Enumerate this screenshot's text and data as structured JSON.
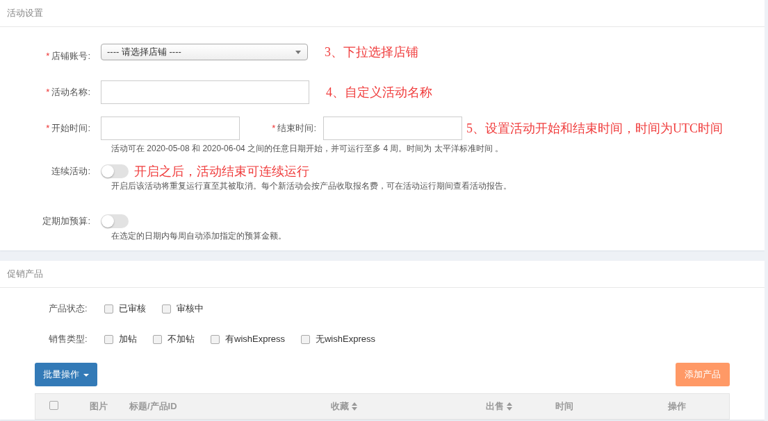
{
  "settings_panel": {
    "title": "活动设置",
    "store": {
      "label": "店铺账号:",
      "required_mark": "*",
      "value": "---- 请选择店铺 ----",
      "note": "3、下拉选择店铺"
    },
    "name": {
      "label": "活动名称:",
      "required_mark": "*",
      "note": "4、自定义活动名称"
    },
    "start": {
      "label": "开始时间:",
      "required_mark": "*"
    },
    "end": {
      "label": "结束时间:",
      "required_mark": "*",
      "note": "5、设置活动开始和结束时间，时间为UTC时间"
    },
    "date_help": "活动可在 2020-05-08 和 2020-06-04 之间的任意日期开始，并可运行至多 4 周。时间为 太平洋标准时间 。",
    "toggles": [
      {
        "label": "连续活动:",
        "on": false,
        "note": "开启之后，活动结束可连续运行",
        "help": "开启后该活动将重复运行直至其被取消。每个新活动会按产品收取报名费，可在活动运行期间查看活动报告。"
      },
      {
        "label": "定期加预算:",
        "on": false,
        "help": "在选定的日期内每周自动添加指定的预算金额。"
      }
    ]
  },
  "products_panel": {
    "title": "促销产品",
    "filters": [
      {
        "label": "产品状态:",
        "options": [
          {
            "label": "已审核",
            "checked": false
          },
          {
            "label": "审核中",
            "checked": false
          }
        ]
      },
      {
        "label": "销售类型:",
        "options": [
          {
            "label": "加钻",
            "checked": false
          },
          {
            "label": "不加钻",
            "checked": false
          },
          {
            "label": "有wishExpress",
            "checked": false
          },
          {
            "label": "无wishExpress",
            "checked": false
          }
        ]
      }
    ],
    "bulk_button": "批量操作",
    "add_button": "添加产品",
    "table": {
      "select_all_checked": false,
      "columns": [
        {
          "label": "图片",
          "sortable": false
        },
        {
          "label": "标题/产品ID",
          "sortable": false
        },
        {
          "label": "收藏",
          "sortable": true
        },
        {
          "label": "出售",
          "sortable": true
        },
        {
          "label": "时间",
          "sortable": false
        },
        {
          "label": "操作",
          "sortable": false
        }
      ]
    }
  }
}
